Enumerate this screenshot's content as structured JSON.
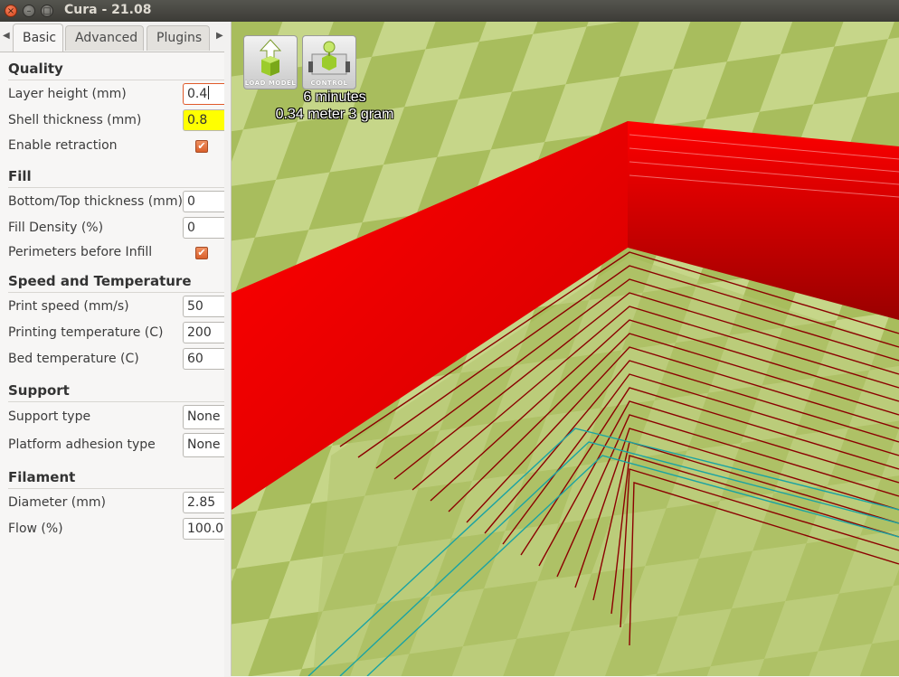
{
  "window": {
    "title": "Cura - 21.08",
    "close_glyph": "×",
    "min_glyph": "–",
    "max_glyph": "□"
  },
  "tabs": {
    "left_arrow": "◀",
    "right_arrow": "▶",
    "items": [
      {
        "label": "Basic",
        "active": true
      },
      {
        "label": "Advanced",
        "active": false
      },
      {
        "label": "Plugins",
        "active": false
      }
    ]
  },
  "settings": {
    "quality": {
      "title": "Quality",
      "layer_height_label": "Layer height (mm)",
      "layer_height_value": "0.4",
      "shell_thickness_label": "Shell thickness (mm)",
      "shell_thickness_value": "0.8",
      "retraction_label": "Enable retraction",
      "retraction_checked": true
    },
    "fill": {
      "title": "Fill",
      "bottom_top_label": "Bottom/Top thickness (mm)",
      "bottom_top_value": "0",
      "density_label": "Fill Density (%)",
      "density_value": "0",
      "perimeters_label": "Perimeters before Infill",
      "perimeters_checked": true
    },
    "speed": {
      "title": "Speed and Temperature",
      "print_speed_label": "Print speed (mm/s)",
      "print_speed_value": "50",
      "print_temp_label": "Printing temperature (C)",
      "print_temp_value": "200",
      "bed_temp_label": "Bed temperature (C)",
      "bed_temp_value": "60"
    },
    "support": {
      "title": "Support",
      "support_type_label": "Support type",
      "support_type_value": "None",
      "adhesion_label": "Platform adhesion type",
      "adhesion_value": "None"
    },
    "filament": {
      "title": "Filament",
      "diameter_label": "Diameter (mm)",
      "diameter_value": "2.85",
      "flow_label": "Flow (%)",
      "flow_value": "100.0"
    },
    "check_glyph": "✔"
  },
  "viewport": {
    "load_model_caption": "LOAD MODEL",
    "control_caption": "CONTROL",
    "print_time": "6 minutes",
    "material": "0.34 meter 3 gram",
    "colors": {
      "bed_light": "#c8d88a",
      "bed_dark": "#a9bf5e",
      "wall_red": "#ff0000",
      "wall_dark": "#8b0000",
      "travel_cyan": "#1aa3a3"
    }
  }
}
